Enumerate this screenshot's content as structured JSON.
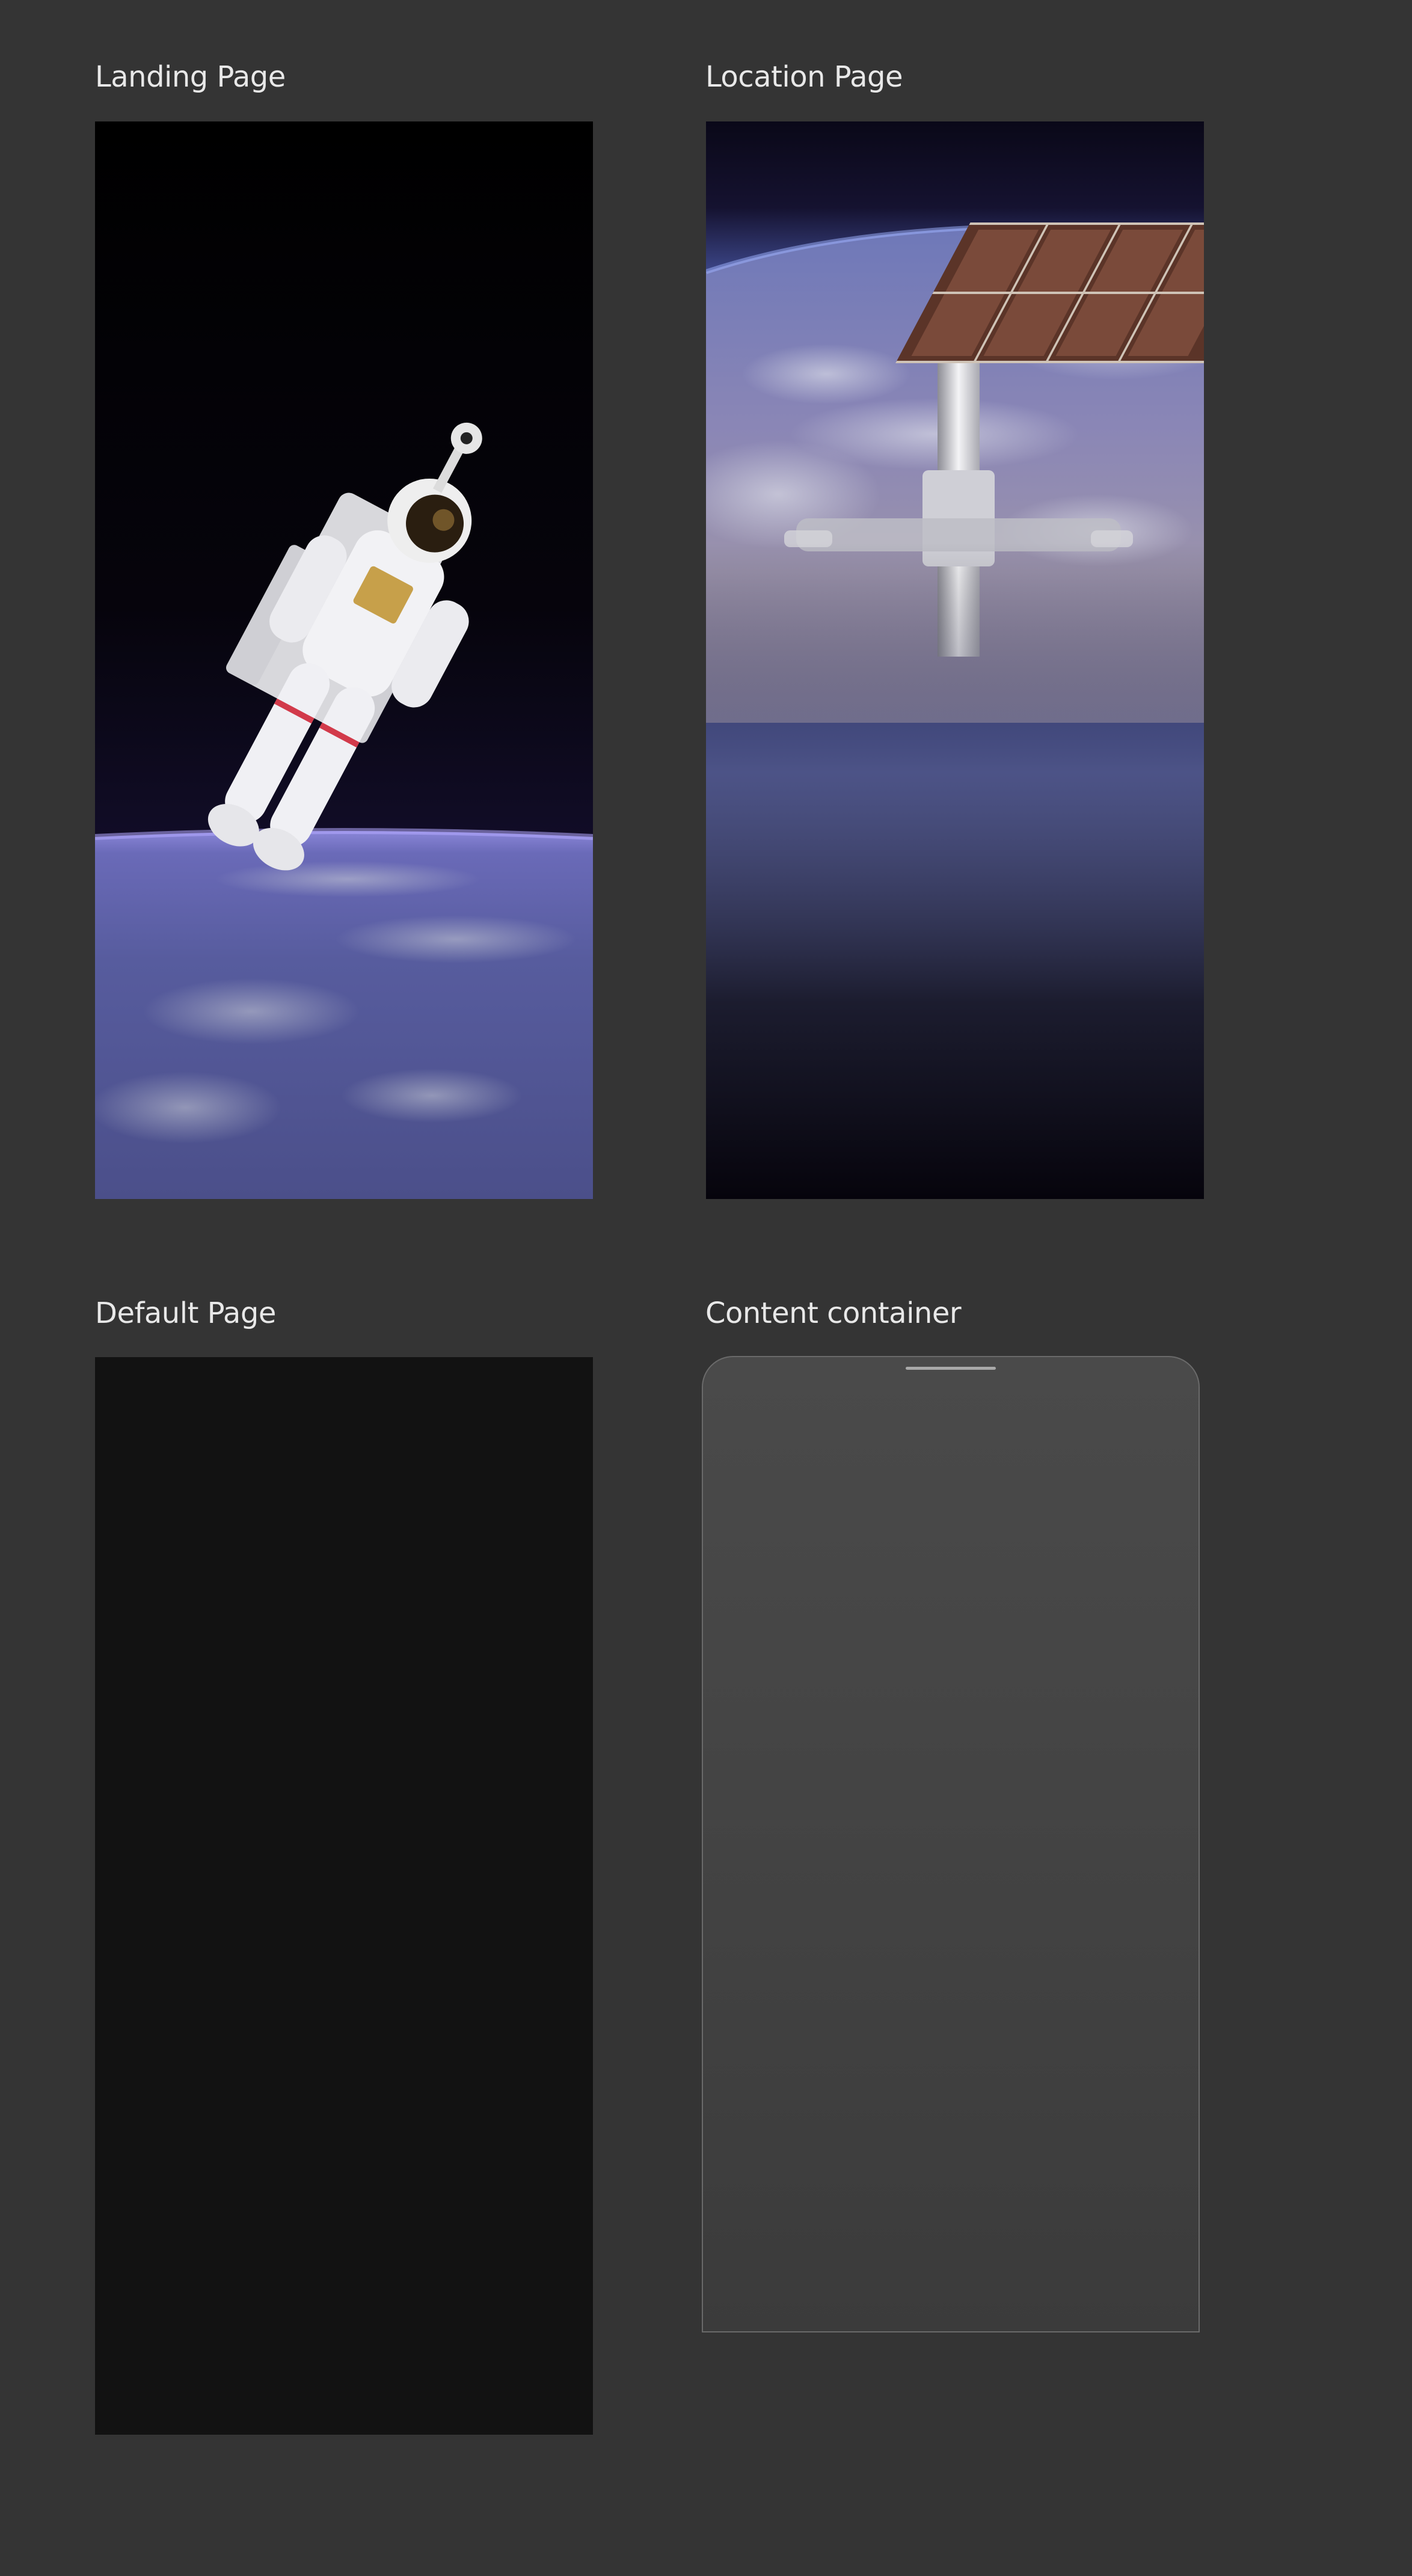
{
  "screens": {
    "landing": {
      "title": "Landing Page"
    },
    "location": {
      "title": "Location Page"
    },
    "default": {
      "title": "Default Page"
    },
    "content": {
      "title": "Content container"
    }
  },
  "colors": {
    "canvas_background": "#343434",
    "label_text": "#e8e8e8",
    "default_page_background": "#121212",
    "content_container_fill": "#474747",
    "content_container_border": "#6a6a6a",
    "grab_handle": "#a9a9a9"
  }
}
